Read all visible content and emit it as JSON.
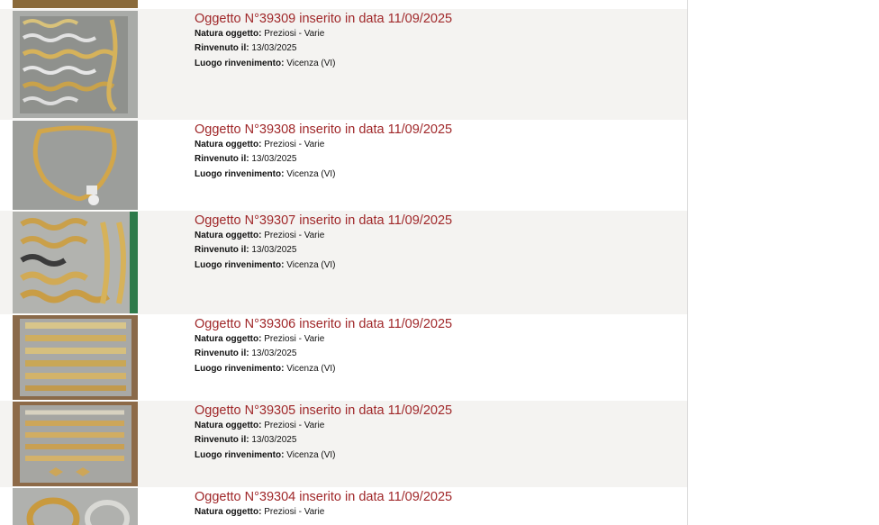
{
  "colors": {
    "title": "#a0282a",
    "row_shaded": "#f4f3f1",
    "row_plain": "#ffffff"
  },
  "labels": {
    "natura": "Natura oggetto:",
    "rinvenuto": "Rinvenuto il:",
    "luogo": "Luogo rinvenimento:"
  },
  "items": [
    {
      "title": "Oggetto N°39309 inserito in data 11/09/2025",
      "natura": "Preziosi - Varie",
      "rinvenuto": "13/03/2025",
      "luogo": "Vicenza (VI)",
      "thumb_icon": "jewelry-photo"
    },
    {
      "title": "Oggetto N°39308 inserito in data 11/09/2025",
      "natura": "Preziosi - Varie",
      "rinvenuto": "13/03/2025",
      "luogo": "Vicenza (VI)",
      "thumb_icon": "jewelry-photo"
    },
    {
      "title": "Oggetto N°39307 inserito in data 11/09/2025",
      "natura": "Preziosi - Varie",
      "rinvenuto": "13/03/2025",
      "luogo": "Vicenza (VI)",
      "thumb_icon": "jewelry-photo"
    },
    {
      "title": "Oggetto N°39306 inserito in data 11/09/2025",
      "natura": "Preziosi - Varie",
      "rinvenuto": "13/03/2025",
      "luogo": "Vicenza (VI)",
      "thumb_icon": "jewelry-photo"
    },
    {
      "title": "Oggetto N°39305 inserito in data 11/09/2025",
      "natura": "Preziosi - Varie",
      "rinvenuto": "13/03/2025",
      "luogo": "Vicenza (VI)",
      "thumb_icon": "jewelry-photo"
    },
    {
      "title": "Oggetto N°39304 inserito in data 11/09/2025",
      "natura": "Preziosi - Varie",
      "rinvenuto": "",
      "luogo": "",
      "thumb_icon": "jewelry-photo"
    }
  ]
}
